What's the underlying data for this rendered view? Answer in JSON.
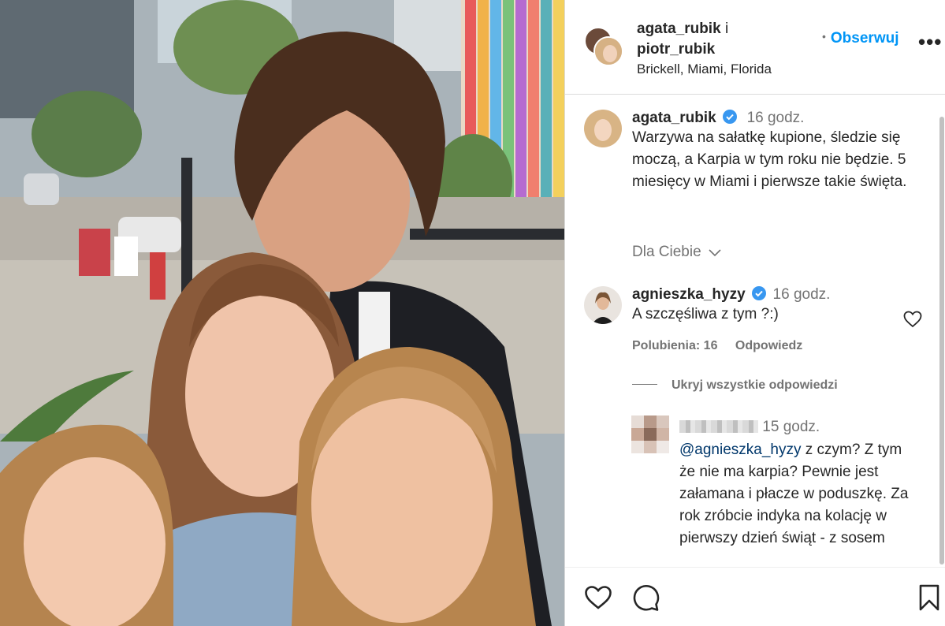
{
  "post": {
    "authors": "agata_rubik",
    "and_word": "i",
    "coauthor": "piotr_rubik",
    "location": "Brickell, Miami, Florida",
    "follow_label": "Obserwuj",
    "more_label": "•••"
  },
  "caption": {
    "username": "agata_rubik",
    "time": "16 godz.",
    "text": "Warzywa na sałatkę kupione, śledzie się moczą, a Karpia w tym roku nie będzie. 5 miesięcy w Miami i pierwsze takie święta."
  },
  "for_you_label": "Dla Ciebie",
  "comment": {
    "username": "agnieszka_hyzy",
    "time": "16 godz.",
    "text": "A szczęśliwa z tym ?:)",
    "likes_label": "Polubienia: 16",
    "reply_label": "Odpowiedz"
  },
  "hide_replies_label": "Ukryj wszystkie odpowiedzi",
  "reply": {
    "time": "15 godz.",
    "mention": "@agnieszka_hyzy",
    "text": " z czym? Z tym że nie ma karpia? Pewnie jest załamana i płacze w poduszkę. Za rok zróbcie indyka na kolację w pierwszy dzień świąt - z sosem"
  },
  "colors": {
    "accent_blue": "#0095f6",
    "verified_blue": "#3897f0",
    "muted_gray": "#737373",
    "text": "#262626"
  },
  "icons": [
    "heart-icon",
    "comment-icon",
    "bookmark-icon",
    "verified-icon",
    "chevron-down-icon"
  ]
}
